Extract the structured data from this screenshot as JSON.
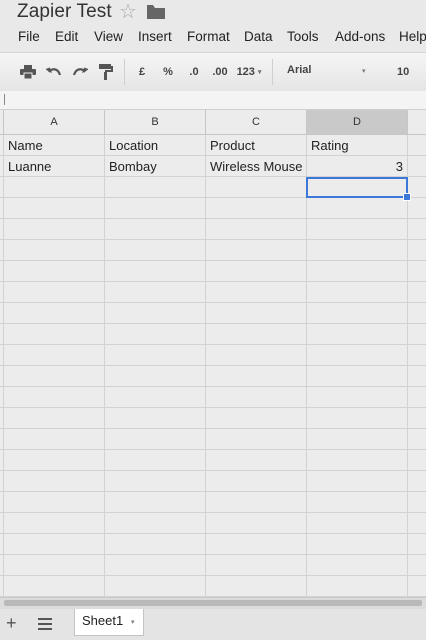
{
  "document": {
    "title": "Zapier Test"
  },
  "menu": [
    "File",
    "Edit",
    "View",
    "Insert",
    "Format",
    "Data",
    "Tools",
    "Add-ons",
    "Help"
  ],
  "toolbar": {
    "currency": "£",
    "percent": "%",
    "decrease_decimal": ".0",
    "increase_decimal": ".00",
    "more_formats": "123",
    "font": "Arial",
    "font_size": "10",
    "icons": [
      "print-icon",
      "undo-icon",
      "redo-icon",
      "paint-format-icon"
    ]
  },
  "columns": [
    "A",
    "B",
    "C",
    "D"
  ],
  "selected_column": "D",
  "rows": [
    [
      "Name",
      "Location",
      "Product",
      "Rating"
    ],
    [
      "Luanne",
      "Bombay",
      "Wireless Mouse",
      "3"
    ]
  ],
  "selected_cell": "D3",
  "sheets": [
    {
      "name": "Sheet1",
      "active": true
    }
  ],
  "colors": {
    "selection": "#3b78d8",
    "selected_header": "#c9c9c9"
  }
}
